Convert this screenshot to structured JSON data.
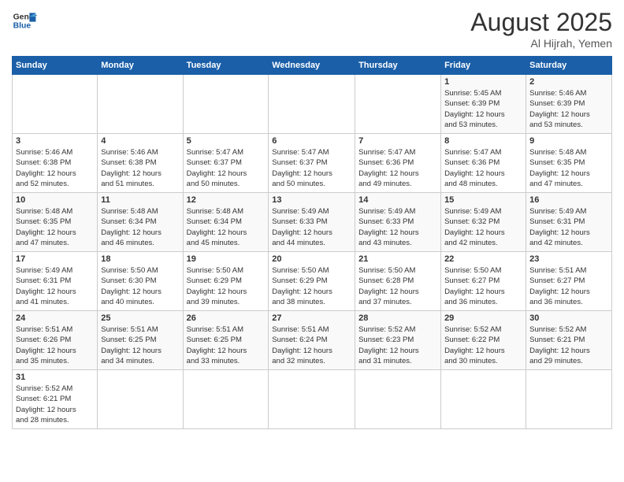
{
  "header": {
    "logo_general": "General",
    "logo_blue": "Blue",
    "title": "August 2025",
    "subtitle": "Al Hijrah, Yemen"
  },
  "weekdays": [
    "Sunday",
    "Monday",
    "Tuesday",
    "Wednesday",
    "Thursday",
    "Friday",
    "Saturday"
  ],
  "weeks": [
    [
      {
        "day": "",
        "info": ""
      },
      {
        "day": "",
        "info": ""
      },
      {
        "day": "",
        "info": ""
      },
      {
        "day": "",
        "info": ""
      },
      {
        "day": "",
        "info": ""
      },
      {
        "day": "1",
        "info": "Sunrise: 5:45 AM\nSunset: 6:39 PM\nDaylight: 12 hours\nand 53 minutes."
      },
      {
        "day": "2",
        "info": "Sunrise: 5:46 AM\nSunset: 6:39 PM\nDaylight: 12 hours\nand 53 minutes."
      }
    ],
    [
      {
        "day": "3",
        "info": "Sunrise: 5:46 AM\nSunset: 6:38 PM\nDaylight: 12 hours\nand 52 minutes."
      },
      {
        "day": "4",
        "info": "Sunrise: 5:46 AM\nSunset: 6:38 PM\nDaylight: 12 hours\nand 51 minutes."
      },
      {
        "day": "5",
        "info": "Sunrise: 5:47 AM\nSunset: 6:37 PM\nDaylight: 12 hours\nand 50 minutes."
      },
      {
        "day": "6",
        "info": "Sunrise: 5:47 AM\nSunset: 6:37 PM\nDaylight: 12 hours\nand 50 minutes."
      },
      {
        "day": "7",
        "info": "Sunrise: 5:47 AM\nSunset: 6:36 PM\nDaylight: 12 hours\nand 49 minutes."
      },
      {
        "day": "8",
        "info": "Sunrise: 5:47 AM\nSunset: 6:36 PM\nDaylight: 12 hours\nand 48 minutes."
      },
      {
        "day": "9",
        "info": "Sunrise: 5:48 AM\nSunset: 6:35 PM\nDaylight: 12 hours\nand 47 minutes."
      }
    ],
    [
      {
        "day": "10",
        "info": "Sunrise: 5:48 AM\nSunset: 6:35 PM\nDaylight: 12 hours\nand 47 minutes."
      },
      {
        "day": "11",
        "info": "Sunrise: 5:48 AM\nSunset: 6:34 PM\nDaylight: 12 hours\nand 46 minutes."
      },
      {
        "day": "12",
        "info": "Sunrise: 5:48 AM\nSunset: 6:34 PM\nDaylight: 12 hours\nand 45 minutes."
      },
      {
        "day": "13",
        "info": "Sunrise: 5:49 AM\nSunset: 6:33 PM\nDaylight: 12 hours\nand 44 minutes."
      },
      {
        "day": "14",
        "info": "Sunrise: 5:49 AM\nSunset: 6:33 PM\nDaylight: 12 hours\nand 43 minutes."
      },
      {
        "day": "15",
        "info": "Sunrise: 5:49 AM\nSunset: 6:32 PM\nDaylight: 12 hours\nand 42 minutes."
      },
      {
        "day": "16",
        "info": "Sunrise: 5:49 AM\nSunset: 6:31 PM\nDaylight: 12 hours\nand 42 minutes."
      }
    ],
    [
      {
        "day": "17",
        "info": "Sunrise: 5:49 AM\nSunset: 6:31 PM\nDaylight: 12 hours\nand 41 minutes."
      },
      {
        "day": "18",
        "info": "Sunrise: 5:50 AM\nSunset: 6:30 PM\nDaylight: 12 hours\nand 40 minutes."
      },
      {
        "day": "19",
        "info": "Sunrise: 5:50 AM\nSunset: 6:29 PM\nDaylight: 12 hours\nand 39 minutes."
      },
      {
        "day": "20",
        "info": "Sunrise: 5:50 AM\nSunset: 6:29 PM\nDaylight: 12 hours\nand 38 minutes."
      },
      {
        "day": "21",
        "info": "Sunrise: 5:50 AM\nSunset: 6:28 PM\nDaylight: 12 hours\nand 37 minutes."
      },
      {
        "day": "22",
        "info": "Sunrise: 5:50 AM\nSunset: 6:27 PM\nDaylight: 12 hours\nand 36 minutes."
      },
      {
        "day": "23",
        "info": "Sunrise: 5:51 AM\nSunset: 6:27 PM\nDaylight: 12 hours\nand 36 minutes."
      }
    ],
    [
      {
        "day": "24",
        "info": "Sunrise: 5:51 AM\nSunset: 6:26 PM\nDaylight: 12 hours\nand 35 minutes."
      },
      {
        "day": "25",
        "info": "Sunrise: 5:51 AM\nSunset: 6:25 PM\nDaylight: 12 hours\nand 34 minutes."
      },
      {
        "day": "26",
        "info": "Sunrise: 5:51 AM\nSunset: 6:25 PM\nDaylight: 12 hours\nand 33 minutes."
      },
      {
        "day": "27",
        "info": "Sunrise: 5:51 AM\nSunset: 6:24 PM\nDaylight: 12 hours\nand 32 minutes."
      },
      {
        "day": "28",
        "info": "Sunrise: 5:52 AM\nSunset: 6:23 PM\nDaylight: 12 hours\nand 31 minutes."
      },
      {
        "day": "29",
        "info": "Sunrise: 5:52 AM\nSunset: 6:22 PM\nDaylight: 12 hours\nand 30 minutes."
      },
      {
        "day": "30",
        "info": "Sunrise: 5:52 AM\nSunset: 6:21 PM\nDaylight: 12 hours\nand 29 minutes."
      }
    ],
    [
      {
        "day": "31",
        "info": "Sunrise: 5:52 AM\nSunset: 6:21 PM\nDaylight: 12 hours\nand 28 minutes."
      },
      {
        "day": "",
        "info": ""
      },
      {
        "day": "",
        "info": ""
      },
      {
        "day": "",
        "info": ""
      },
      {
        "day": "",
        "info": ""
      },
      {
        "day": "",
        "info": ""
      },
      {
        "day": "",
        "info": ""
      }
    ]
  ]
}
